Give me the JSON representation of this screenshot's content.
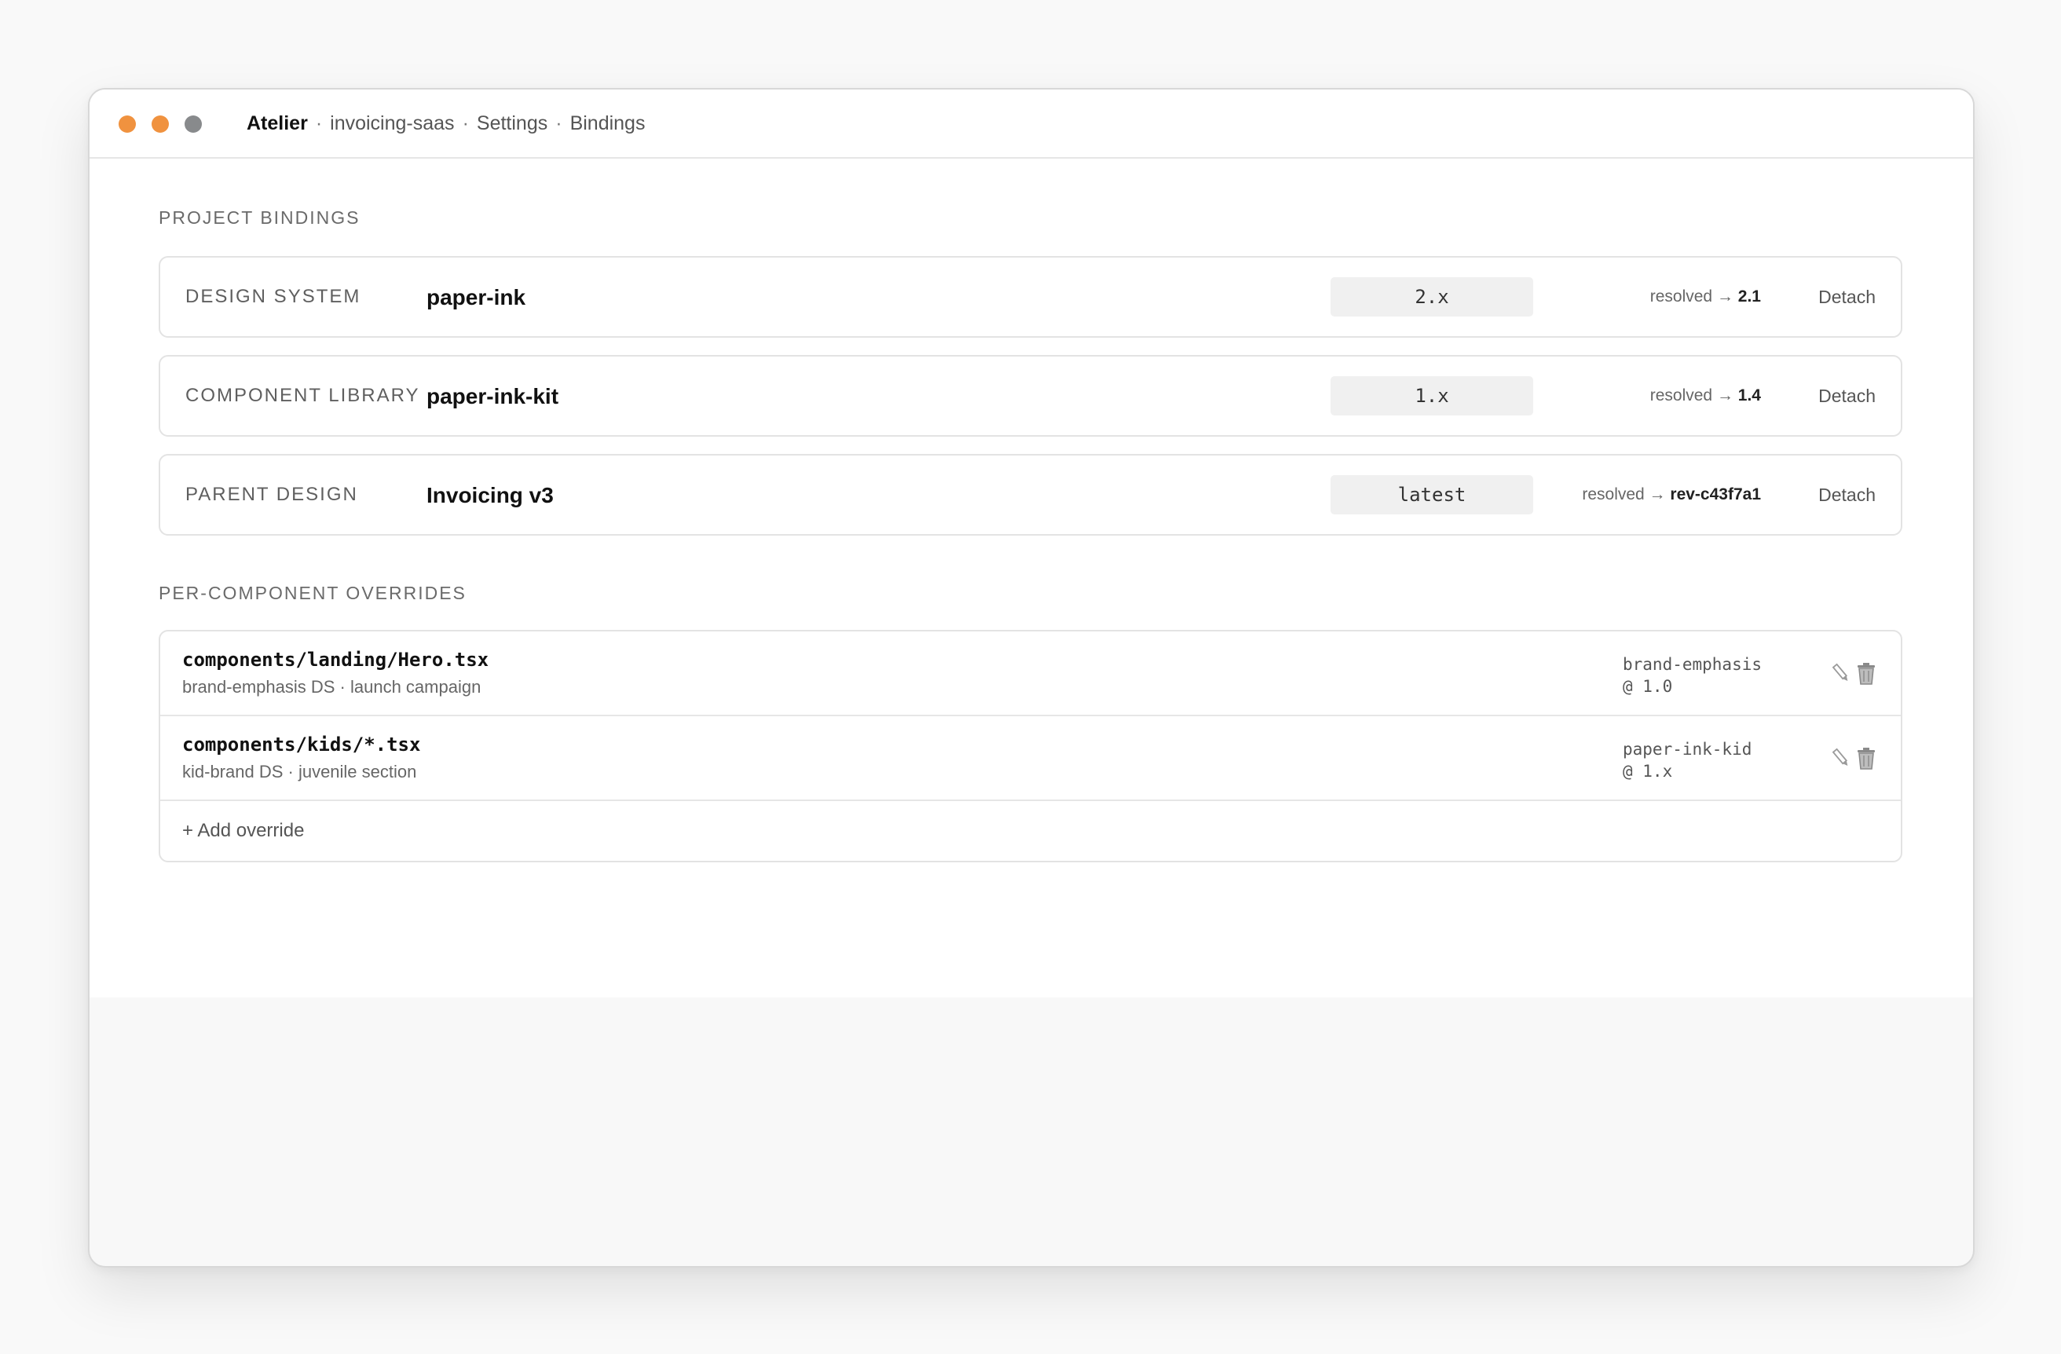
{
  "titlebar": {
    "app_name": "Atelier",
    "separator": "·",
    "crumbs": [
      "invoicing-saas",
      "Settings",
      "Bindings"
    ]
  },
  "project_bindings": {
    "heading": "PROJECT BINDINGS",
    "items": [
      {
        "kind": "DESIGN SYSTEM",
        "name": "paper-ink",
        "version": "2.x",
        "resolved_prefix": "resolved →",
        "resolved_value": "2.1",
        "action": "Detach"
      },
      {
        "kind": "COMPONENT LIBRARY",
        "name": "paper-ink-kit",
        "version": "1.x",
        "resolved_prefix": "resolved →",
        "resolved_value": "1.4",
        "action": "Detach"
      },
      {
        "kind": "PARENT DESIGN",
        "name": "Invoicing v3",
        "version": "latest",
        "resolved_prefix": "resolved →",
        "resolved_value": "rev-c43f7a1",
        "action": "Detach"
      }
    ]
  },
  "overrides": {
    "heading": "PER-COMPONENT OVERRIDES",
    "items": [
      {
        "path": "components/landing/Hero.tsx",
        "description": "brand-emphasis DS · launch campaign",
        "target_name": "brand-emphasis",
        "target_version": "@ 1.0",
        "edit_icon": "pencil-icon",
        "delete_icon": "trash-icon"
      },
      {
        "path": "components/kids/*.tsx",
        "description": "kid-brand DS · juvenile section",
        "target_name": "paper-ink-kid",
        "target_version": "@ 1.x",
        "edit_icon": "pencil-icon",
        "delete_icon": "trash-icon"
      }
    ],
    "add_label": "+ Add override"
  },
  "colors": {
    "traffic_close": "#f0923f",
    "traffic_minimize": "#f0923f",
    "traffic_maximize": "#888a8c"
  }
}
